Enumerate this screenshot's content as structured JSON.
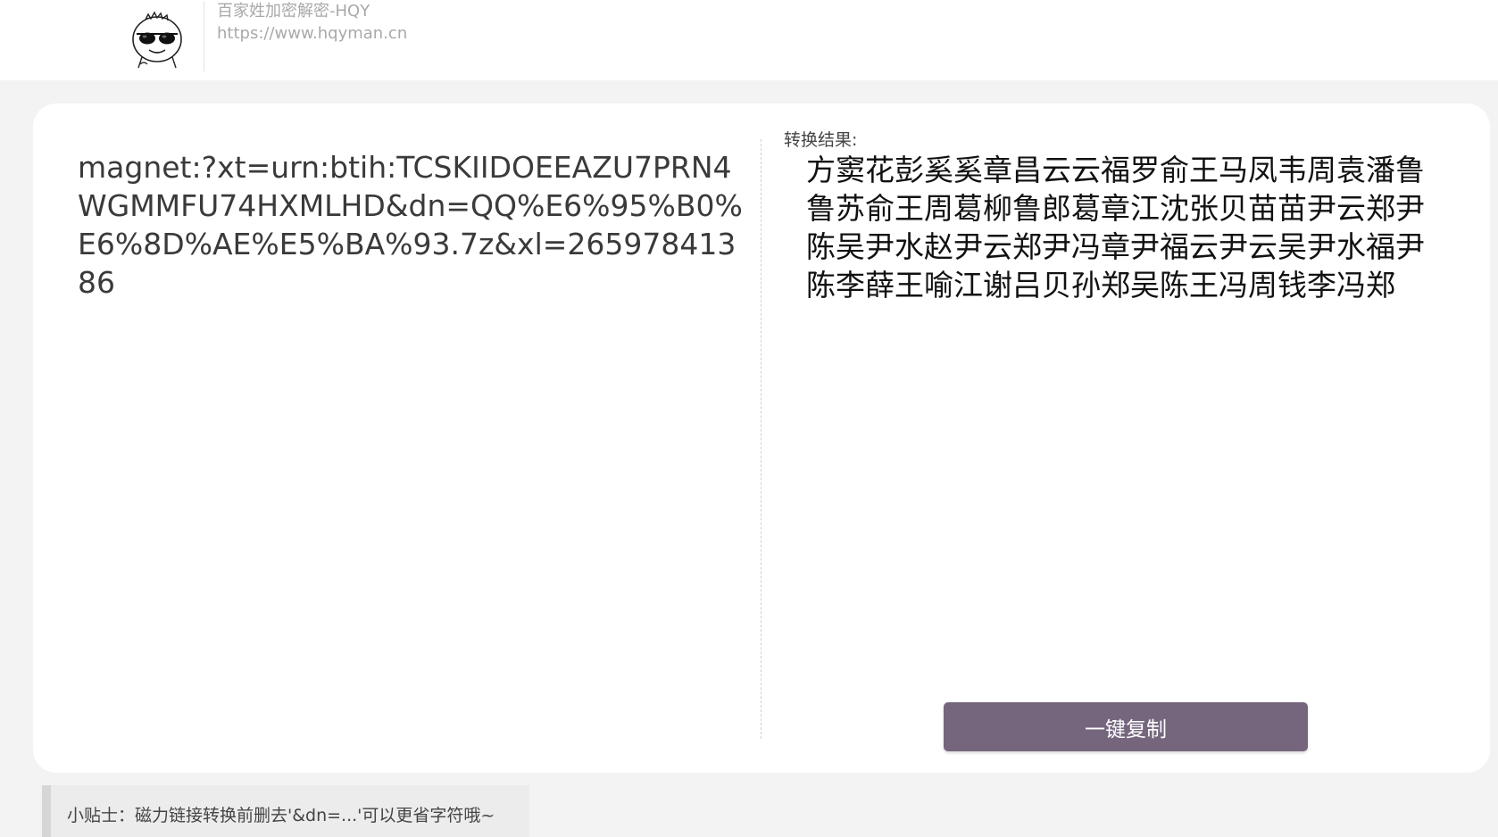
{
  "header": {
    "title": "百家姓加密解密-HQY",
    "url": "https://www.hqyman.cn",
    "logo_icon": "sunglasses-meme-face-icon"
  },
  "converter": {
    "input_value": "magnet:?xt=urn:btih:TCSKIIDOEEAZU7PRN4WGMMFU74HXMLHD&dn=QQ%E6%95%B0%E6%8D%AE%E5%BA%93.7z&xl=26597841386",
    "result_label": "转换结果:",
    "result_text": "方窦花彭奚奚章昌云云福罗俞王马凤韦周袁潘鲁鲁苏俞王周葛柳鲁郎葛章江沈张贝苗苗尹云郑尹陈吴尹水赵尹云郑尹冯章尹福云尹云吴尹水福尹陈李薛王喻江谢吕贝孙郑吴陈王冯周钱李冯郑",
    "copy_button_label": "一键复制"
  },
  "tip": {
    "text": "小贴士：磁力链接转换前删去'&dn=...'可以更省字符哦~"
  },
  "colors": {
    "page_background": "#f3f3f4",
    "card_background": "#ffffff",
    "button_background": "#75667e",
    "header_text": "#a9a9a9"
  }
}
